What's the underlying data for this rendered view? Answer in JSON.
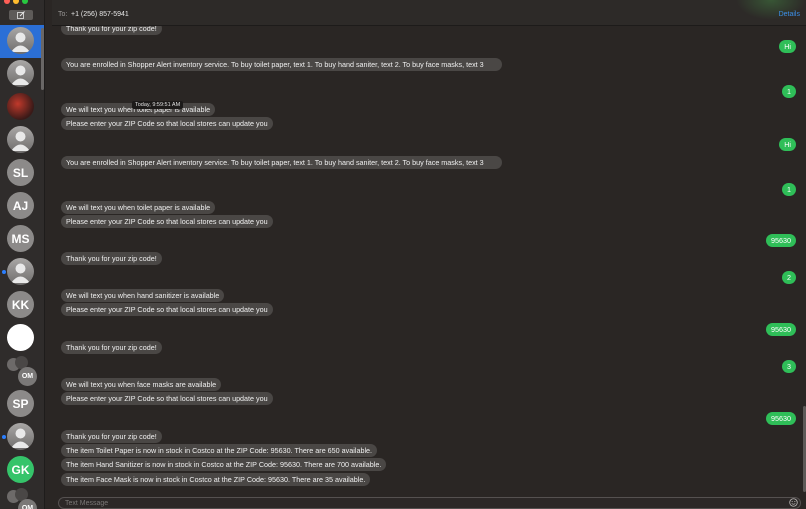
{
  "window": {
    "traffic_lights": [
      "close",
      "minimize",
      "zoom"
    ]
  },
  "sidebar": {
    "compose_icon": "compose-icon",
    "conversations": [
      {
        "type": "person",
        "selected": true
      },
      {
        "type": "person"
      },
      {
        "type": "photo"
      },
      {
        "type": "person"
      },
      {
        "type": "initials",
        "initials": "SL"
      },
      {
        "type": "initials",
        "initials": "AJ"
      },
      {
        "type": "initials",
        "initials": "MS"
      },
      {
        "type": "person",
        "unread": true
      },
      {
        "type": "initials",
        "initials": "KK"
      },
      {
        "type": "white"
      },
      {
        "type": "group",
        "initials": "OM"
      },
      {
        "type": "initials",
        "initials": "SP"
      },
      {
        "type": "person",
        "unread": true
      },
      {
        "type": "initials",
        "initials": "GK",
        "color": "#35c46a"
      },
      {
        "type": "group",
        "initials": "OM"
      }
    ]
  },
  "header": {
    "to_label": "To:",
    "recipient": "+1 (256) 857-5941",
    "details_label": "Details"
  },
  "messages": {
    "timestamp": "Today, 9:59:51 AM",
    "items": [
      {
        "dir": "recv",
        "text": "Thank you for your zip code!"
      },
      {
        "dir": "sent",
        "text": "Hi"
      },
      {
        "dir": "recv",
        "text": "You are enrolled in Shopper Alert inventory service. To buy toilet paper, text 1. To buy hand saniter, text 2. To buy face masks, text 3"
      },
      {
        "dir": "sent",
        "text": "1"
      },
      {
        "dir": "recv",
        "text": "We will text you when toilet paper is available"
      },
      {
        "dir": "recv",
        "text": "Please enter your ZIP Code so that local stores can update you"
      },
      {
        "dir": "sent",
        "text": "Hi"
      },
      {
        "dir": "recv",
        "text": "You are enrolled in Shopper Alert inventory service. To buy toilet paper, text 1. To buy hand saniter, text 2. To buy face masks, text 3"
      },
      {
        "dir": "sent",
        "text": "1"
      },
      {
        "dir": "recv",
        "text": "We will text you when toilet paper is available"
      },
      {
        "dir": "recv",
        "text": "Please enter your ZIP Code so that local stores can update you"
      },
      {
        "dir": "sent",
        "text": "95630"
      },
      {
        "dir": "recv",
        "text": "Thank you for your zip code!"
      },
      {
        "dir": "sent",
        "text": "2"
      },
      {
        "dir": "recv",
        "text": "We will text you when hand sanitizer is available"
      },
      {
        "dir": "recv",
        "text": "Please enter your ZIP Code so that local stores can update you"
      },
      {
        "dir": "sent",
        "text": "95630"
      },
      {
        "dir": "recv",
        "text": "Thank you for your zip code!"
      },
      {
        "dir": "sent",
        "text": "3"
      },
      {
        "dir": "recv",
        "text": "We will text you when face masks are available"
      },
      {
        "dir": "recv",
        "text": "Please enter your ZIP Code so that local stores can update you"
      },
      {
        "dir": "sent",
        "text": "95630"
      },
      {
        "dir": "recv",
        "text": "Thank you for your zip code!"
      },
      {
        "dir": "recv",
        "text": "The item Toilet Paper is now in stock in Costco at the ZIP Code: 95630. There are 650 available."
      },
      {
        "dir": "recv",
        "text": "The item Hand Sanitizer is now in stock in Costco at the ZIP Code: 95630. There are 700 available."
      },
      {
        "dir": "recv",
        "text": "The item Face Mask is now in stock in Costco at the ZIP Code: 95630. There are 35 available."
      }
    ]
  },
  "input": {
    "placeholder": "Text Message",
    "emoji_icon": "emoji-icon"
  },
  "colors": {
    "sent_bubble": "#2fbe58",
    "recv_bubble": "#4a4745",
    "selection": "#2b6fd6",
    "link": "#3d8fe8"
  }
}
